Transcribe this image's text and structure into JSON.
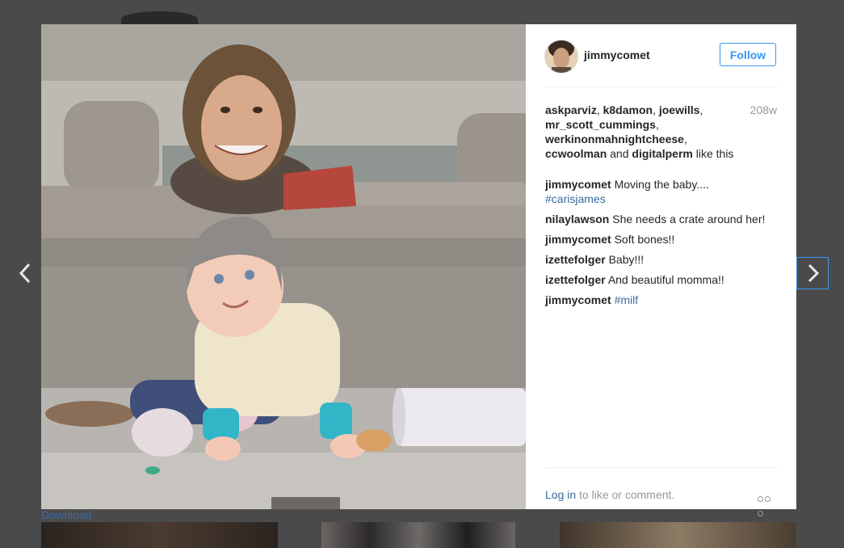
{
  "post": {
    "username": "jimmycomet",
    "follow_label": "Follow",
    "age": "208w",
    "likers": [
      "askparviz",
      "k8damon",
      "joewills",
      "mr_scott_cummings",
      "werkinonmahnightcheese",
      "ccwoolman"
    ],
    "likers_and": "and",
    "last_liker": "digitalperm",
    "likes_suffix": "like this"
  },
  "comments": [
    {
      "user": "jimmycomet",
      "text": "Moving the baby....",
      "tag": "#carisjames"
    },
    {
      "user": "nilaylawson",
      "text": "She needs a crate around her!",
      "tag": ""
    },
    {
      "user": "jimmycomet",
      "text": "Soft bones!!",
      "tag": ""
    },
    {
      "user": "izettefolger",
      "text": "Baby!!!",
      "tag": ""
    },
    {
      "user": "izettefolger",
      "text": "And beautiful momma!!",
      "tag": ""
    },
    {
      "user": "jimmycomet",
      "text": "",
      "tag": "#milf"
    }
  ],
  "footer": {
    "login_link": "Log in",
    "login_text": "to like or comment."
  },
  "download_label": "Download",
  "icons": {
    "prev": "chevron-left-icon",
    "next": "chevron-right-icon",
    "more": "more-options-icon"
  },
  "colors": {
    "follow_blue": "#3897f0",
    "link_blue": "#3d6a9e",
    "backdrop": "#4a4a4a"
  }
}
